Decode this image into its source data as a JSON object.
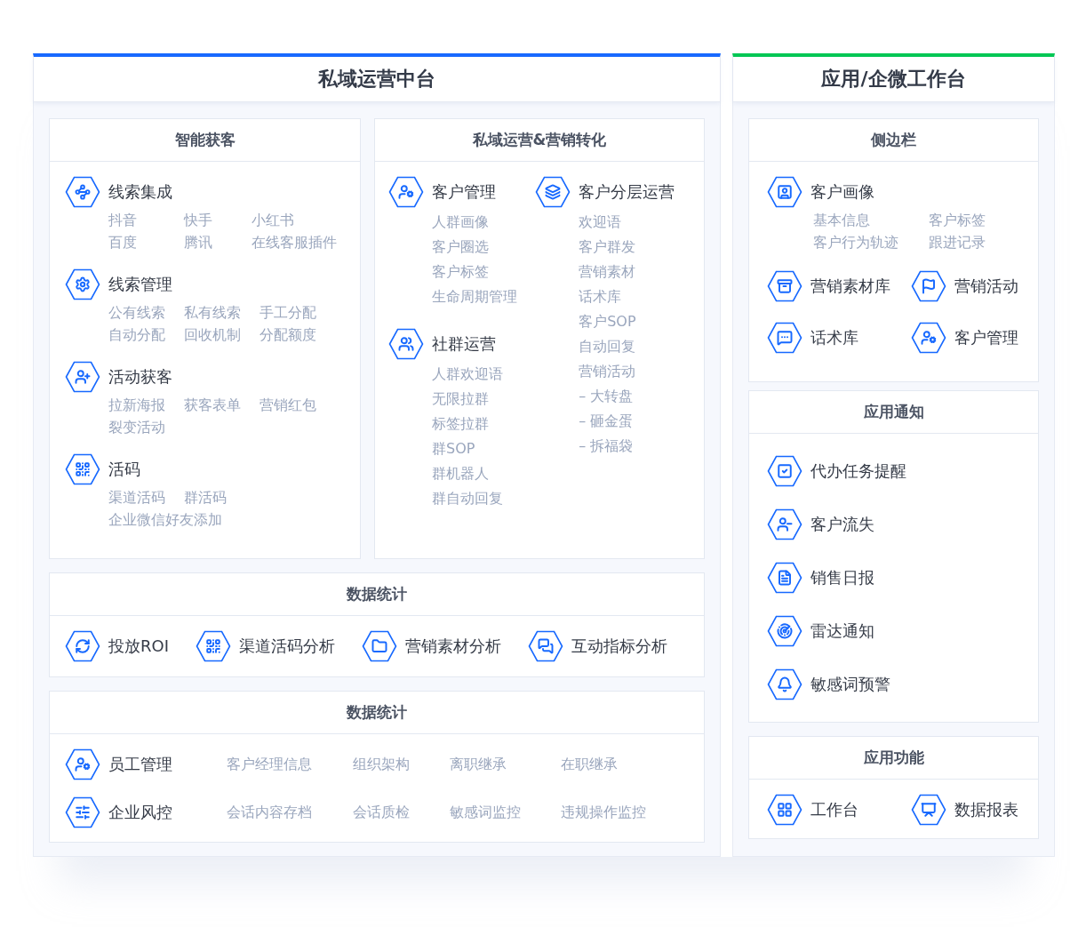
{
  "platform": {
    "title": "私域运营中台",
    "capture": {
      "title": "智能获客",
      "groups": [
        {
          "title": "线索集成",
          "rows": [
            [
              "抖音",
              "快手",
              "小红书"
            ],
            [
              "百度",
              "腾讯",
              "在线客服插件"
            ]
          ]
        },
        {
          "title": "线索管理",
          "rows": [
            [
              "公有线索",
              "私有线索",
              "手工分配"
            ],
            [
              "自动分配",
              "回收机制",
              "分配额度"
            ]
          ]
        },
        {
          "title": "活动获客",
          "rows": [
            [
              "拉新海报",
              "获客表单",
              "营销红包"
            ],
            [
              "裂变活动"
            ]
          ]
        },
        {
          "title": "活码",
          "rows": [
            [
              "渠道活码",
              "群活码"
            ],
            [
              "企业微信好友添加"
            ]
          ]
        }
      ]
    },
    "conversion": {
      "title": "私域运营&营销转化",
      "columns": [
        [
          {
            "title": "客户管理",
            "items": [
              "人群画像",
              "客户圈选",
              "客户标签",
              "生命周期管理"
            ]
          },
          {
            "title": "社群运营",
            "items": [
              "人群欢迎语",
              "无限拉群",
              "标签拉群",
              "群SOP",
              "群机器人",
              "群自动回复"
            ]
          }
        ],
        [
          {
            "title": "客户分层运营",
            "items": [
              "欢迎语",
              "客户群发",
              "营销素材",
              "话术库",
              "客户SOP",
              "自动回复",
              "营销活动",
              "– 大转盘",
              "– 砸金蛋",
              "– 拆福袋"
            ]
          }
        ]
      ]
    },
    "analytics": {
      "title": "数据统计",
      "items": [
        "投放ROI",
        "渠道活码分析",
        "营销素材分析",
        "互动指标分析"
      ]
    },
    "management": {
      "title": "数据统计",
      "rows": [
        {
          "title": "员工管理",
          "items": [
            "客户经理信息",
            "组织架构",
            "离职继承",
            "在职继承"
          ]
        },
        {
          "title": "企业风控",
          "items": [
            "会话内容存档",
            "会话质检",
            "敏感词监控",
            "违规操作监控"
          ]
        }
      ]
    }
  },
  "workbench": {
    "title": "应用/企微工作台",
    "sidebar": {
      "title": "侧边栏",
      "profile": {
        "title": "客户画像",
        "rows": [
          [
            "基本信息",
            "客户标签"
          ],
          [
            "客户行为轨迹",
            "跟进记录"
          ]
        ]
      },
      "tools": [
        "营销素材库",
        "营销活动",
        "话术库",
        "客户管理"
      ]
    },
    "notifications": {
      "title": "应用通知",
      "items": [
        "代办任务提醒",
        "客户流失",
        "销售日报",
        "雷达通知",
        "敏感词预警"
      ]
    },
    "functions": {
      "title": "应用功能",
      "items": [
        "工作台",
        "数据报表"
      ]
    }
  }
}
